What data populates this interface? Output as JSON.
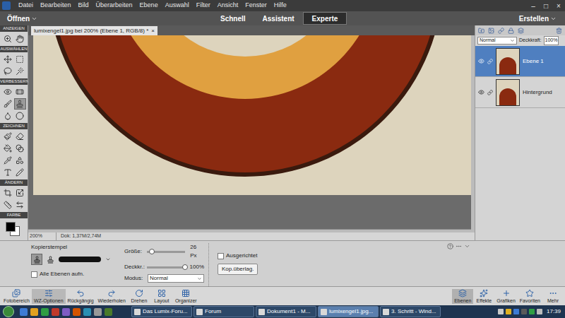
{
  "menu_bar": {
    "items": [
      "Datei",
      "Bearbeiten",
      "Bild",
      "Überarbeiten",
      "Ebene",
      "Auswahl",
      "Filter",
      "Ansicht",
      "Fenster",
      "Hilfe"
    ],
    "controls": [
      "–",
      "□",
      "×"
    ]
  },
  "mode_bar": {
    "open": "Öffnen",
    "tabs": [
      {
        "label": "Schnell",
        "selected": false
      },
      {
        "label": "Assistent",
        "selected": false
      },
      {
        "label": "Experte",
        "selected": true
      }
    ],
    "create": "Erstellen"
  },
  "document": {
    "tab": "lumixengel1.jpg bei 200% (Ebene 1, RGB/8) *",
    "close": "×",
    "zoom": "200%",
    "info": "Dok: 1,37M/2,74M"
  },
  "toolbox": {
    "sections": [
      {
        "label": "ANZEIGEN",
        "tools": [
          {
            "selected": false
          },
          {
            "selected": false
          }
        ]
      },
      {
        "label": "AUSWÄHLEN",
        "tools": [
          {
            "selected": false
          },
          {
            "selected": false
          },
          {
            "selected": false
          },
          {
            "selected": false
          }
        ]
      },
      {
        "label": "VERBESSERN",
        "tools": [
          {
            "selected": false
          },
          {
            "selected": false
          },
          {
            "selected": false
          },
          {
            "selected": true
          },
          {
            "selected": false
          },
          {
            "selected": false
          }
        ]
      },
      {
        "label": "ZEICHNEN",
        "tools": [
          {
            "selected": false
          },
          {
            "selected": false
          },
          {
            "selected": false
          },
          {
            "selected": false
          },
          {
            "selected": false
          },
          {
            "selected": false
          },
          {
            "selected": false
          },
          {
            "selected": false
          }
        ]
      },
      {
        "label": "ÄNDERN",
        "tools": [
          {
            "selected": false
          },
          {
            "selected": false
          },
          {
            "selected": false
          },
          {
            "selected": false
          }
        ]
      }
    ],
    "color_label": "FARBE",
    "foreground": "#000000",
    "background": "#ffffff"
  },
  "layers_panel": {
    "blend_mode": "Normal",
    "opacity_label": "Deckkraft:",
    "opacity": "100%",
    "layers": [
      {
        "name": "Ebene 1",
        "selected": true,
        "visible": true
      },
      {
        "name": "Hintergrund",
        "selected": false,
        "visible": true
      }
    ]
  },
  "tool_options": {
    "tool": "Kopierstempel",
    "all_layers": {
      "label": "Alle Ebenen aufn.",
      "checked": false
    },
    "sliders": [
      {
        "label": "Größe:",
        "level": 0.12,
        "reading": "26 Px"
      },
      {
        "label": "Deckkr.:",
        "level": 1,
        "reading": "100%"
      }
    ],
    "mode": {
      "label": "Modus:",
      "value": "Normal"
    },
    "aligned": {
      "label": "Ausgerichtet",
      "checked": false
    },
    "overlay_button": "Kop.überlag."
  },
  "bottom_bar": {
    "left": [
      {
        "label": "Fotobereich",
        "selected": false
      },
      {
        "label": "WZ-Optionen",
        "selected": true
      },
      {
        "label": "Rückgängig",
        "selected": false
      },
      {
        "label": "Wiederholen",
        "selected": false
      },
      {
        "label": "Drehen",
        "selected": false
      },
      {
        "label": "Layout",
        "selected": false
      },
      {
        "label": "Organizer",
        "selected": false
      }
    ],
    "right": [
      {
        "label": "Ebenen",
        "selected": true
      },
      {
        "label": "Effekte",
        "selected": false
      },
      {
        "label": "Grafiken",
        "selected": false
      },
      {
        "label": "Favoriten",
        "selected": false
      },
      {
        "label": "Mehr",
        "selected": false
      }
    ]
  },
  "taskbar": {
    "tasks": [
      {
        "label": "Das Lumix-Foru...",
        "selected": false
      },
      {
        "label": "Forum",
        "selected": false
      },
      {
        "label": "Dokument1 - M...",
        "selected": false
      },
      {
        "label": "lumixengel1.jpg...",
        "selected": true
      },
      {
        "label": "3. Schritt - Wind...",
        "selected": false
      }
    ],
    "clock": "17:39"
  }
}
